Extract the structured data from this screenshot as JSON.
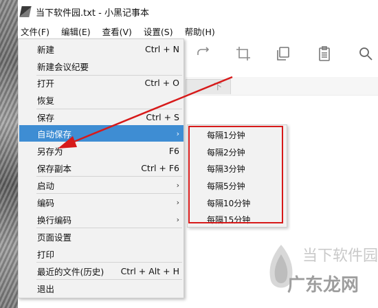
{
  "window": {
    "title": "当下软件园.txt - 小黑记事本"
  },
  "menubar": {
    "items": [
      "文件(F)",
      "编辑(E)",
      "查看(V)",
      "设置(S)",
      "帮助(H)"
    ]
  },
  "tab": {
    "fragment": "下"
  },
  "file_menu": {
    "items": [
      {
        "label": "新建",
        "shortcut": "Ctrl + N"
      },
      {
        "label": "新建会议纪要",
        "shortcut": ""
      },
      {
        "label": "打开",
        "shortcut": "Ctrl + O"
      },
      {
        "label": "恢复",
        "shortcut": ""
      },
      {
        "label": "保存",
        "shortcut": "Ctrl + S"
      },
      {
        "label": "自动保存",
        "shortcut": "",
        "submenu": true,
        "highlighted": true
      },
      {
        "label": "另存为",
        "shortcut": "F6"
      },
      {
        "label": "保存副本",
        "shortcut": "Ctrl + F6"
      },
      {
        "label": "启动",
        "shortcut": "",
        "submenu": true
      },
      {
        "label": "编码",
        "shortcut": "",
        "submenu": true
      },
      {
        "label": "换行编码",
        "shortcut": "",
        "submenu": true
      },
      {
        "label": "页面设置",
        "shortcut": ""
      },
      {
        "label": "打印",
        "shortcut": ""
      },
      {
        "label": "最近的文件(历史)",
        "shortcut": "Ctrl + Alt + H"
      },
      {
        "label": "退出",
        "shortcut": ""
      }
    ],
    "submenu_arrow": "›"
  },
  "autosave_submenu": {
    "items": [
      "每隔1分钟",
      "每隔2分钟",
      "每隔3分钟",
      "每隔5分钟",
      "每隔10分钟",
      "每隔15分钟"
    ]
  },
  "toolbar": {
    "icons": [
      "redo-icon",
      "crop-icon",
      "copy-icon",
      "clipboard-icon",
      "search-icon"
    ]
  },
  "watermark": {
    "line1": "当下软件园",
    "line2": "广东龙网"
  },
  "colors": {
    "highlight": "#3e8dd3",
    "annotation_red": "#d71a1a",
    "menu_bg": "#f2f2f2"
  }
}
